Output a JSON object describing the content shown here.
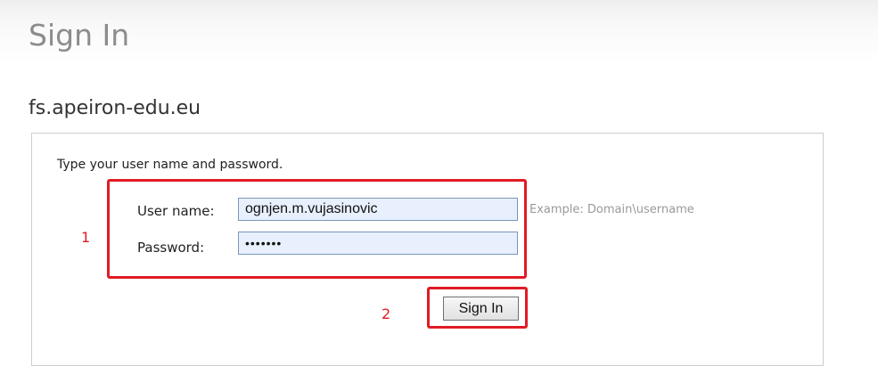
{
  "page": {
    "title": "Sign In",
    "server_name": "fs.apeiron-edu.eu"
  },
  "form": {
    "instructions": "Type your user name and password.",
    "username_label": "User name:",
    "username_value": "ognjen.m.vujasinovic",
    "username_hint": "Example: Domain\\username",
    "password_label": "Password:",
    "password_value": "•••••••",
    "submit_label": "Sign In"
  },
  "annotations": {
    "credentials_marker": "1",
    "submit_marker": "2",
    "color": "#e01b24"
  }
}
